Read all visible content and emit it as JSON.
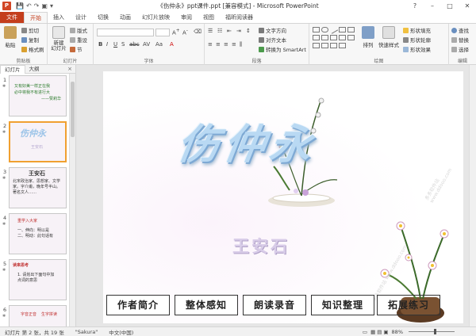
{
  "window": {
    "title": "《伤仲永》ppt课件.ppt [兼容模式] - Microsoft PowerPoint",
    "app_icon": "P",
    "controls": [
      "?",
      "–",
      "□",
      "✕"
    ]
  },
  "ribbon_tabs": [
    "文件",
    "开始",
    "插入",
    "设计",
    "切换",
    "动画",
    "幻灯片放映",
    "审阅",
    "视图",
    "福昕阅读器"
  ],
  "active_tab": "开始",
  "ribbon": {
    "clipboard": {
      "label": "剪贴板",
      "paste": "粘贴",
      "cut": "剪切",
      "copy": "复制",
      "format_painter": "格式刷"
    },
    "slides": {
      "label": "幻灯片",
      "new_slide": "新建\n幻灯片",
      "layout": "版式",
      "reset": "重设",
      "section": "节"
    },
    "font": {
      "label": "字体"
    },
    "paragraph": {
      "label": "段落",
      "text_direction": "文字方向",
      "align_text": "对齐文本",
      "smartart": "转换为 SmartArt"
    },
    "drawing": {
      "label": "绘图",
      "arrange": "排列",
      "quick_styles": "快速样式",
      "shape_fill": "形状填充",
      "shape_outline": "形状轮廓",
      "shape_effects": "形状效果"
    },
    "editing": {
      "label": "编辑",
      "find": "查找",
      "replace": "替换",
      "select": "选择"
    }
  },
  "panel": {
    "tabs": [
      "幻灯片",
      "大纲"
    ],
    "active_tab": "幻灯片",
    "close": "×",
    "thumbnails": [
      {
        "num": "1",
        "line1": "又有好美一样正在我",
        "line2": "必中将我不有进行大",
        "line3": "——赞莉华"
      },
      {
        "num": "2",
        "title": "伤仲永",
        "sub": "王安石"
      },
      {
        "num": "3",
        "title": "王安石",
        "line1": "北宋政治家、思想家、文学",
        "line2": "家。字介甫，晚年号半山。",
        "line3": "著名文人……"
      },
      {
        "num": "4",
        "title": "重学入大家",
        "line1": "一、伸向：明以是",
        "line2": "二、明动：此句话有"
      },
      {
        "num": "5",
        "title": "读来思考",
        "line1": "1. 请划出下面句中加",
        "line2": "点词的意思"
      },
      {
        "num": "6",
        "line1": "字音正音",
        "line2": "生字拼读"
      }
    ]
  },
  "slide": {
    "title": "伤仲永",
    "author": "王安石",
    "nav_buttons": [
      "作者简介",
      "整体感知",
      "朗读录音",
      "知识整理",
      "拓展练习"
    ],
    "watermark": "多多软件站 www.ddooo.com"
  },
  "status": {
    "slide_of": "幻灯片 第 2 张，共 19 张",
    "theme": "\"Sakura\"",
    "language": "中文(中国)",
    "zoom": "88%"
  }
}
